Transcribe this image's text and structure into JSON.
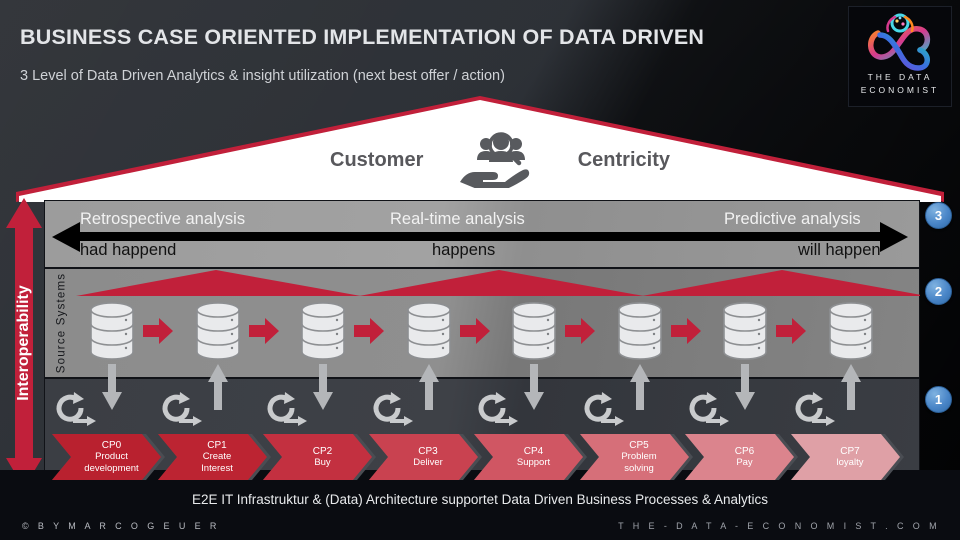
{
  "header": {
    "title": "BUSINESS CASE ORIENTED IMPLEMENTATION OF DATA DRIVEN",
    "subtitle": "3 Level of Data Driven Analytics  & insight utilization  (next  best offer / action)"
  },
  "logo": {
    "line1": "THE DATA",
    "line2": "ECONOMIST",
    "mark_icon": "neural-infinity-icon"
  },
  "roof": {
    "left_word": "Customer",
    "right_word": "Centricity",
    "icon": "hand-holding-people-magnifier-icon"
  },
  "timeline": {
    "items": [
      {
        "analysis": "Retrospective analysis",
        "when": "had happend"
      },
      {
        "analysis": "Real-time  analysis",
        "when": "happens"
      },
      {
        "analysis": "Predictive analysis",
        "when": "will happen"
      }
    ],
    "left_arrow_icon": "arrow-left-icon",
    "right_arrow_icon": "arrow-right-icon"
  },
  "source_systems": {
    "label": "Source  Systems",
    "db_count": 8,
    "db_icon": "database-icon",
    "flow_arrow_icon": "arrow-right-icon",
    "tent_count": 3
  },
  "process_layer": {
    "cycle_icon": "refresh-cycle-icon",
    "up_down_arrow_icon": "arrow-up-down-icon"
  },
  "chevrons": [
    {
      "code": "CP0",
      "label": "Product\ndevelopment",
      "color": "#b9212f"
    },
    {
      "code": "CP1",
      "label": "Create\nInterest",
      "color": "#bc2432"
    },
    {
      "code": "CP2",
      "label": "Buy",
      "color": "#c33040"
    },
    {
      "code": "CP3",
      "label": "Deliver",
      "color": "#c94250"
    },
    {
      "code": "CP4",
      "label": "Support",
      "color": "#d05663"
    },
    {
      "code": "CP5",
      "label": "Problem\nsolving",
      "color": "#d66f79"
    },
    {
      "code": "CP6",
      "label": "Pay",
      "color": "#db848d"
    },
    {
      "code": "CP7",
      "label": "loyalty",
      "color": "#dfa0a6"
    }
  ],
  "interoperability": {
    "label": "Interoperability",
    "icon": "double-arrow-vertical-icon",
    "color": "#c1203a"
  },
  "badges": [
    "3",
    "2",
    "1"
  ],
  "footer": {
    "caption": "E2E IT Infrastruktur  & (Data) Architecture  supportet  Data Driven  Business Processes & Analytics",
    "credit": "© B Y   M A R C O   G E U E R",
    "site": "T H E - D A T A - E C O N O M I S T . C O M"
  },
  "colors": {
    "red": "#c1203a",
    "dark": "#0b0d12",
    "badge_blue": "#4a86c8"
  }
}
